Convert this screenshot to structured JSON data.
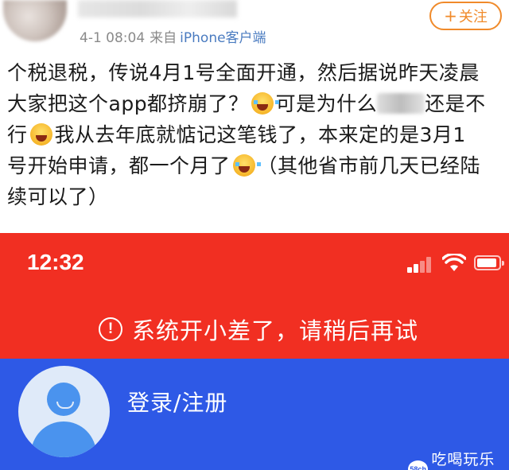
{
  "post": {
    "username": "",
    "time": "4-1 08:04",
    "source_prefix": "来自",
    "device": "iPhone客户端",
    "follow_label": "关注",
    "follow_plus": "+",
    "text": {
      "line1": "个税退税，传说4月1号全面开通，然后据说昨天凌晨",
      "line2a": "大家把这个app都挤崩了？",
      "line2b": "可是为什么",
      "line2c": "还是不",
      "line3a": "行",
      "line3b": "我从去年底就惦记这笔钱了，本来定的是3月1",
      "line4a": "号开始申请，都一个月了",
      "line4b": "（其他省市前几天已经陆",
      "line5": "续可以了）"
    }
  },
  "status_bar": {
    "time": "12:32"
  },
  "error": {
    "icon": "!",
    "message": "系统开小差了，请稍后再试"
  },
  "login": {
    "label": "登录/注册"
  },
  "watermark": {
    "logo": "58ch",
    "text": "吃喝玩乐网"
  },
  "colors": {
    "red": "#f12f22",
    "blue": "#2e59e6",
    "follow_orange": "#f08a2a",
    "link_blue": "#4a7bc0"
  },
  "icons": [
    "crying-laughing-emoji-icon",
    "screaming-emoji-icon",
    "crying-emoji-icon",
    "warning-circle-icon",
    "signal-icon",
    "wifi-icon",
    "battery-icon",
    "user-avatar-icon"
  ]
}
